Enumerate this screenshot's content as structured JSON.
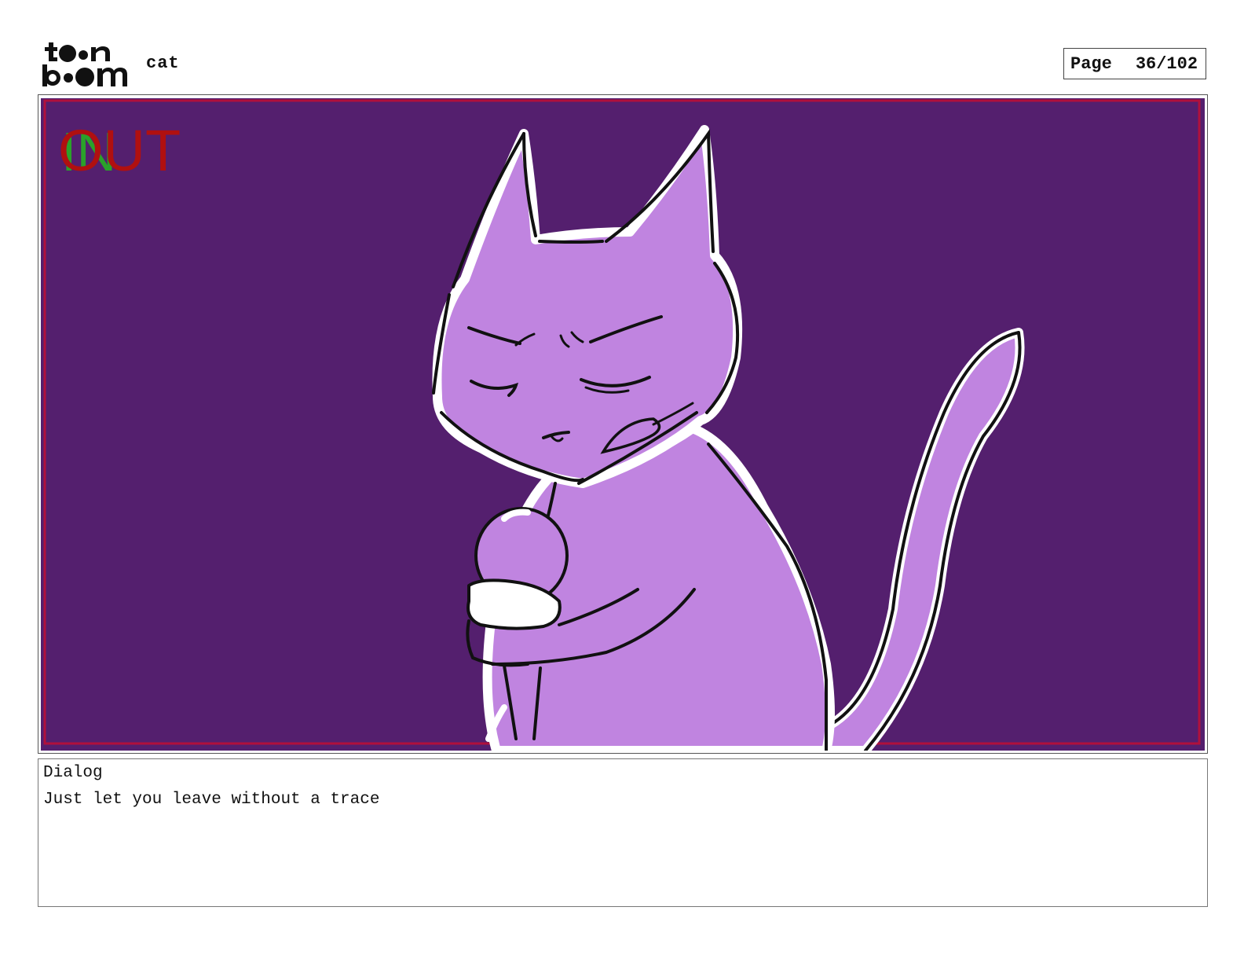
{
  "logo": {
    "line1": "toon",
    "line2": "boom"
  },
  "header": {
    "project_name": "cat",
    "page_label": "Page",
    "page_number": "36/102"
  },
  "panel": {
    "in_marker": "IN",
    "out_marker": "OUT",
    "background_color": "#541f6e",
    "cat_fill_color": "#c084e0",
    "frame_line_color": "#b0103c",
    "subject_icon": "cat-sketch-icon"
  },
  "dialog": {
    "title": "Dialog",
    "text": "Just let you leave without a trace"
  }
}
